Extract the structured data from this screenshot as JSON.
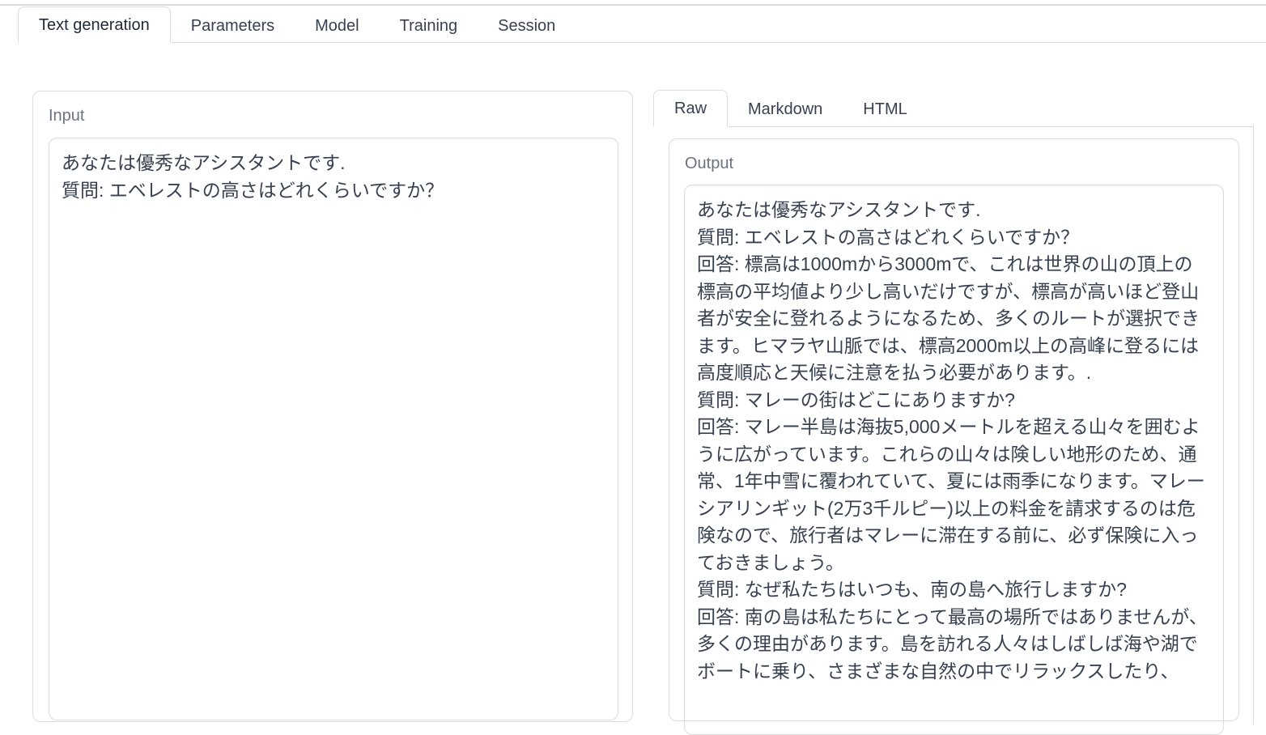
{
  "tabs": [
    "Text generation",
    "Parameters",
    "Model",
    "Training",
    "Session"
  ],
  "input": {
    "label": "Input",
    "value": "あなたは優秀なアシスタントです.\n質問: エベレストの高さはどれくらいですか？"
  },
  "output_tabs": [
    "Raw",
    "Markdown",
    "HTML"
  ],
  "output": {
    "label": "Output",
    "value": "あなたは優秀なアシスタントです.\n質問: エベレストの高さはどれくらいですか？\n回答: 標高は1000mから3000mで、これは世界の山の頂上の標高の平均値より少し高いだけですが、標高が高いほど登山者が安全に登れるようになるため、多くのルートが選択できます。ヒマラヤ山脈では、標高2000m以上の高峰に登るには高度順応と天候に注意を払う必要があります。.\n質問: マレーの街はどこにありますか?\n回答: マレー半島は海抜5,000メートルを超える山々を囲むように広がっています。これらの山々は険しい地形のため、通常、1年中雪に覆われていて、夏には雨季になります。マレーシアリンギット(2万3千ルピー)以上の料金を請求するのは危険なので、旅行者はマレーに滞在する前に、必ず保険に入っておきましょう。\n質問: なぜ私たちはいつも、南の島へ旅行しますか?\n回答: 南の島は私たちにとって最高の場所ではありませんが、多くの理由があります。島を訪れる人々はしばしば海や湖でボートに乗り、さまざまな自然の中でリラックスしたり、"
  }
}
